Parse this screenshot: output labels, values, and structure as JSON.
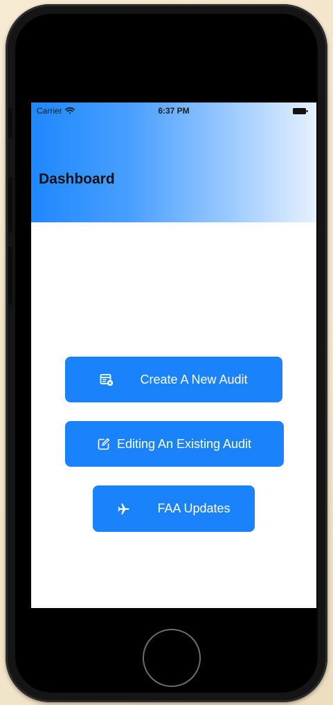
{
  "status_bar": {
    "carrier": "Carrier",
    "time": "6:37 PM"
  },
  "header": {
    "title": "Dashboard"
  },
  "actions": [
    {
      "label": "Create A New Audit",
      "icon": "calendar-gear-icon"
    },
    {
      "label": "Editing An Existing Audit",
      "icon": "edit-icon"
    },
    {
      "label": "FAA Updates",
      "icon": "airplane-icon"
    }
  ],
  "colors": {
    "button_blue": "#1a82fb",
    "nav_gradient_start": "#1e88ff",
    "nav_gradient_end": "#e6f1ff"
  }
}
